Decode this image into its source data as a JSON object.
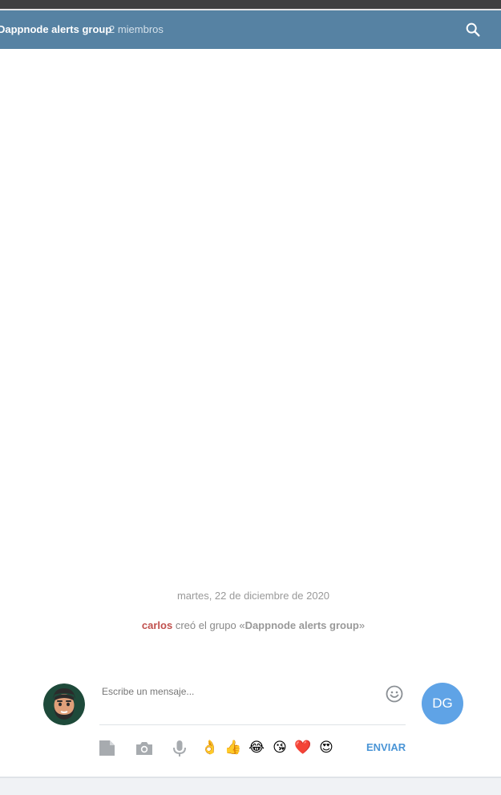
{
  "header": {
    "title": "Dappnode alerts group",
    "members": "2 miembros",
    "search_icon": "search-icon"
  },
  "history": {
    "date": "martes, 22 de diciembre de 2020",
    "service": {
      "author": "carlos",
      "text": " creó el grupo «",
      "group": "Dappnode alerts group",
      "close": "»"
    }
  },
  "composer": {
    "placeholder": "Escribe un mensaje...",
    "send_label": "ENVIAR",
    "peer_initials": "DG",
    "tools": [
      "file-icon",
      "camera-icon",
      "microphone-icon"
    ],
    "emoji": [
      "👌",
      "👍",
      "😂",
      "😘",
      "❤️",
      "😍"
    ]
  },
  "colors": {
    "header_bg": "#5682a3",
    "accent": "#4a95d6",
    "author": "#c0504d",
    "peer_avatar": "#5fa3e6"
  }
}
